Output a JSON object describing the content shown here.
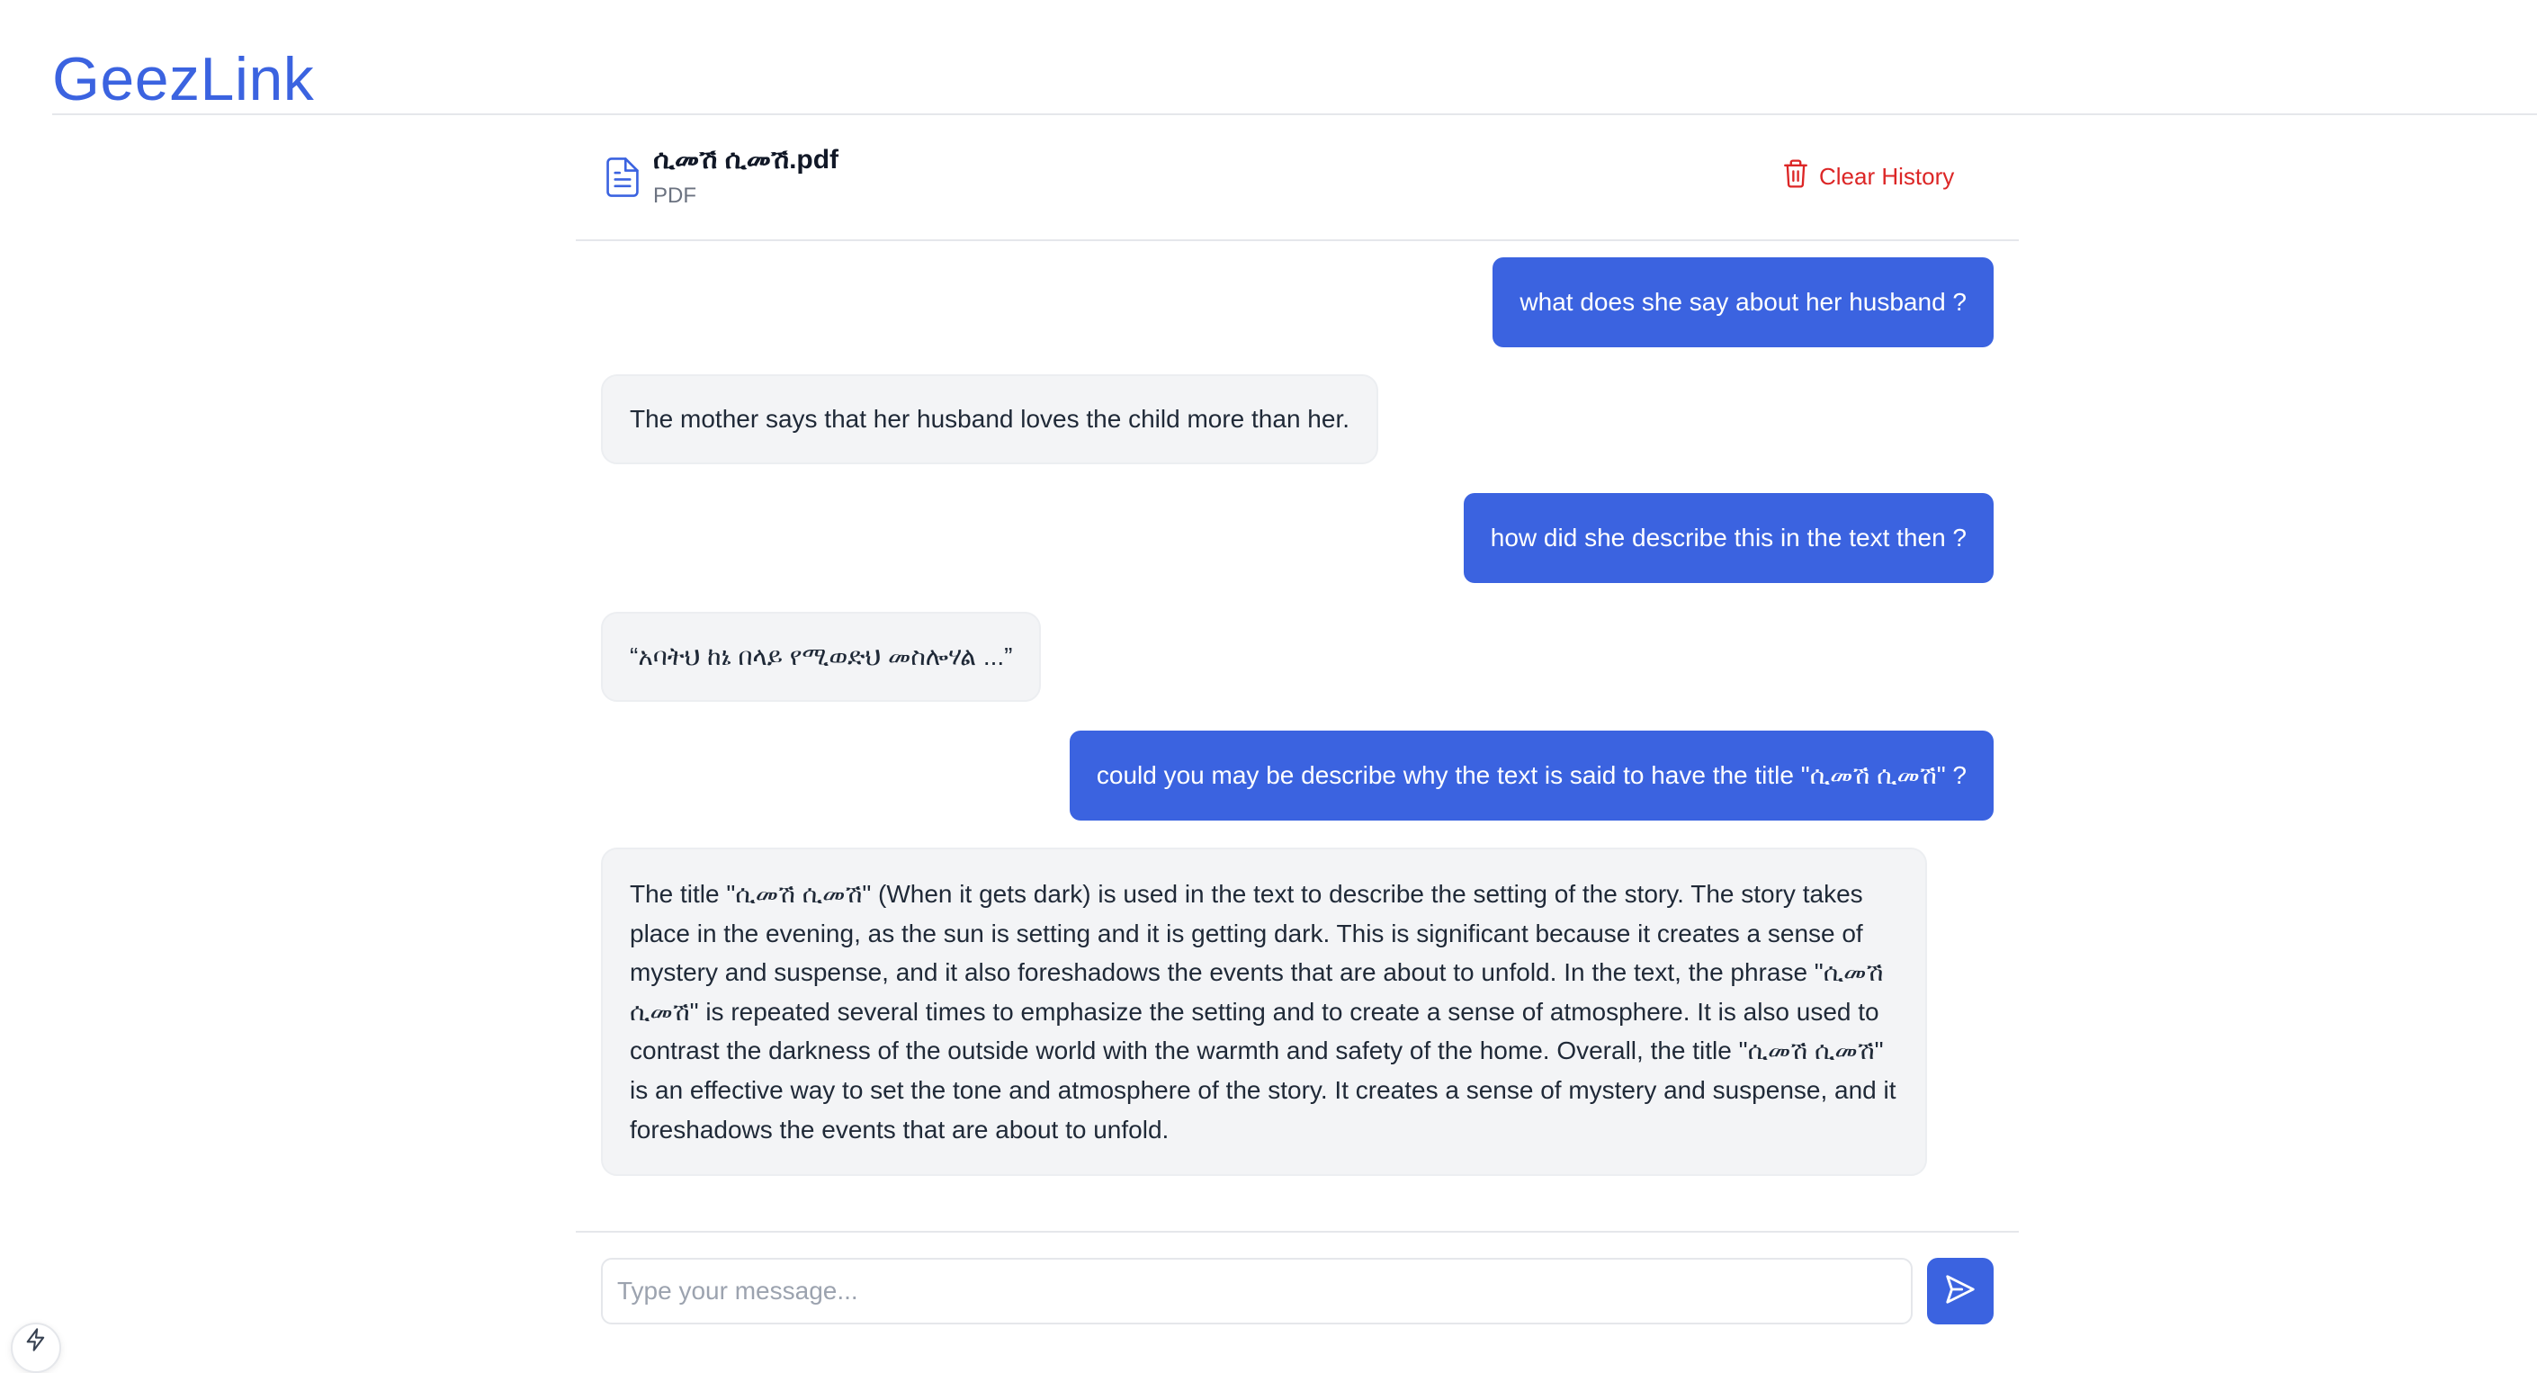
{
  "app": {
    "title": "GeezLink"
  },
  "document": {
    "name": "ሲመሽ ሲመሽ.pdf",
    "type": "PDF",
    "icon": "file-text-icon"
  },
  "header": {
    "clear_history_label": "Clear History",
    "clear_history_icon": "trash-icon"
  },
  "messages": [
    {
      "role": "user",
      "text": "what does she say about her husband ?"
    },
    {
      "role": "assistant",
      "text": "The mother says that her husband loves the child more than her."
    },
    {
      "role": "user",
      "text": "how did she describe this in the text then ?"
    },
    {
      "role": "assistant",
      "text": "“አባትህ ከኔ በላይ የሚወድህ መስሎሃል ...”"
    },
    {
      "role": "user",
      "text": "could you may be describe why the text is said to have the title \"ሲመሽ ሲመሽ\" ?"
    },
    {
      "role": "assistant",
      "text": "The title \"ሲመሽ ሲመሽ\" (When it gets dark) is used in the text to describe the setting of the story. The story takes place in the evening, as the sun is setting and it is getting dark. This is significant because it creates a sense of mystery and suspense, and it also foreshadows the events that are about to unfold. In the text, the phrase \"ሲመሽ ሲመሽ\" is repeated several times to emphasize the setting and to create a sense of atmosphere. It is also used to contrast the darkness of the outside world with the warmth and safety of the home. Overall, the title \"ሲመሽ ሲመሽ\" is an effective way to set the tone and atmosphere of the story. It creates a sense of mystery and suspense, and it foreshadows the events that are about to unfold."
    }
  ],
  "composer": {
    "placeholder": "Type your message...",
    "value": "",
    "send_icon": "send-icon"
  },
  "floating": {
    "icon": "bolt-icon"
  },
  "colors": {
    "accent": "#3b63e0",
    "danger": "#dc2626",
    "bot_bubble": "#f3f4f6"
  }
}
